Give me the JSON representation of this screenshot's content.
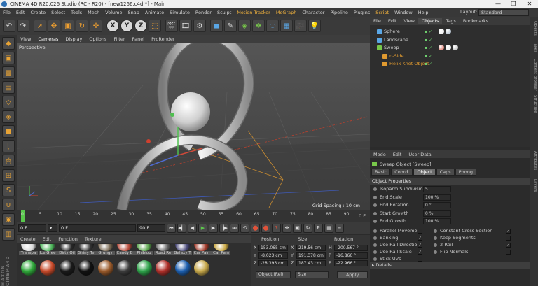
{
  "window": {
    "title": "CINEMA 4D R20.026 Studio (RC - R20) - [new1266.c4d *] - Main",
    "controls": [
      "—",
      "❐",
      "✕"
    ]
  },
  "menubar": {
    "items": [
      "File",
      "Edit",
      "Create",
      "Select",
      "Tools",
      "Mesh",
      "Volume",
      "Snap",
      "Animate",
      "Simulate",
      "Render",
      "Sculpt",
      "Motion Tracker",
      "MoGraph",
      "Character",
      "Pipeline",
      "Plugins",
      "Script",
      "Window",
      "Help"
    ],
    "layout_label": "Layout:",
    "layout_value": "Standard"
  },
  "viewport": {
    "menu": [
      "View",
      "Cameras",
      "Display",
      "Options",
      "Filter",
      "Panel",
      "ProRender"
    ],
    "label": "Perspective",
    "grid_spacing": "Grid Spacing : 10 cm"
  },
  "timeline": {
    "ticks": [
      "0",
      "5",
      "10",
      "15",
      "20",
      "25",
      "30",
      "35",
      "40",
      "45",
      "50",
      "55",
      "60",
      "65",
      "70",
      "75",
      "80",
      "85",
      "90"
    ],
    "end_frame": "0 F"
  },
  "transport": {
    "start": "0 F",
    "current": "0 F",
    "end1": "90 F",
    "end2": "90 F"
  },
  "materials": {
    "menu": [
      "Create",
      "Edit",
      "Function",
      "Texture"
    ],
    "row1": [
      {
        "label": "Transpa",
        "color": "#d8d8d8"
      },
      {
        "label": "Ice Gree",
        "color": "#4cb55a"
      },
      {
        "label": "Dirty Oil",
        "color": "#2a2a2a"
      },
      {
        "label": "Shiny Te",
        "color": "#333333"
      },
      {
        "label": "Grungy",
        "color": "#7a6a54"
      },
      {
        "label": "Candy B",
        "color": "#b84a3a"
      },
      {
        "label": "Phibiou",
        "color": "#58a34a"
      },
      {
        "label": "Road Re",
        "color": "#666666"
      },
      {
        "label": "Galaxy T",
        "color": "#4a4a7a"
      },
      {
        "label": "Car Pain",
        "color": "#a33a2a"
      },
      {
        "label": "Car Pain",
        "color": "#c9a640"
      }
    ],
    "row2_colors": [
      "#2fa83a",
      "#c84a2a",
      "#1a1a1a",
      "#111111",
      "#9a5a2a",
      "#3c3c3c",
      "#2ea34a",
      "#b0302a",
      "#1c5fb0",
      "#c7a84a"
    ]
  },
  "coords": {
    "headers": [
      "Position",
      "Size",
      "Rotation"
    ],
    "rows": [
      {
        "axis": "X",
        "pos": "153.065 cm",
        "size_axis": "X",
        "size": "219.56 cm",
        "rot_axis": "H",
        "rot": "-200.567 °"
      },
      {
        "axis": "Y",
        "pos": "-8.023 cm",
        "size_axis": "Y",
        "size": "191.378 cm",
        "rot_axis": "P",
        "rot": "-16.866 °"
      },
      {
        "axis": "Z",
        "pos": "-28.393 cm",
        "size_axis": "Z",
        "size": "187.43 cm",
        "rot_axis": "B",
        "rot": "-22.966 °"
      }
    ],
    "mode": "Object (Rel)",
    "size_mode": "Size",
    "apply": "Apply"
  },
  "objects_panel": {
    "tabs": [
      "File",
      "Edit",
      "View",
      "Objects",
      "Tags",
      "Bookmarks"
    ],
    "items": [
      {
        "name": "Sphere",
        "indent": 0,
        "color": "#5aa7e6",
        "text_color": "#d0d0d0"
      },
      {
        "name": "Landscape",
        "indent": 0,
        "color": "#5aa7e6",
        "text_color": "#d0d0d0"
      },
      {
        "name": "Sweep",
        "indent": 0,
        "color": "#78c84a",
        "text_color": "#d0d0d0"
      },
      {
        "name": "n-Side",
        "indent": 1,
        "color": "#e09a30",
        "text_color": "#e09a30"
      },
      {
        "name": "Helix Knot Object",
        "indent": 1,
        "color": "#e09a30",
        "text_color": "#e09a30"
      }
    ]
  },
  "attributes": {
    "menu": [
      "Mode",
      "Edit",
      "User Data"
    ],
    "title": "Sweep Object [Sweep]",
    "tabs": [
      "Basic",
      "Coord.",
      "Object",
      "Caps",
      "Phong"
    ],
    "section": "Object Properties",
    "props": [
      {
        "label": "Isoparm Subdivision",
        "value": "5"
      },
      {
        "label": "End Scale",
        "value": "100 %"
      },
      {
        "label": "End Rotation",
        "value": "0 °"
      },
      {
        "label": "Start Growth",
        "value": "0 %"
      },
      {
        "label": "End Growth",
        "value": "100 %"
      }
    ],
    "checks_left": [
      {
        "label": "Parallel Movement",
        "checked": false
      },
      {
        "label": "Banking",
        "checked": true
      },
      {
        "label": "Use Rail Direction",
        "checked": true
      },
      {
        "label": "Use Rail Scale",
        "checked": true
      },
      {
        "label": "Stick UVs",
        "checked": false
      }
    ],
    "checks_right": [
      {
        "label": "Constant Cross Section",
        "checked": true
      },
      {
        "label": "Keep Segments",
        "checked": false
      },
      {
        "label": "2-Rail",
        "checked": true
      },
      {
        "label": "Flip Normals",
        "checked": false
      }
    ],
    "details": "▸ Details"
  },
  "right_strip": [
    "Objects",
    "Takes",
    "Content Browser",
    "Structure",
    "Attributes",
    "Layers"
  ]
}
